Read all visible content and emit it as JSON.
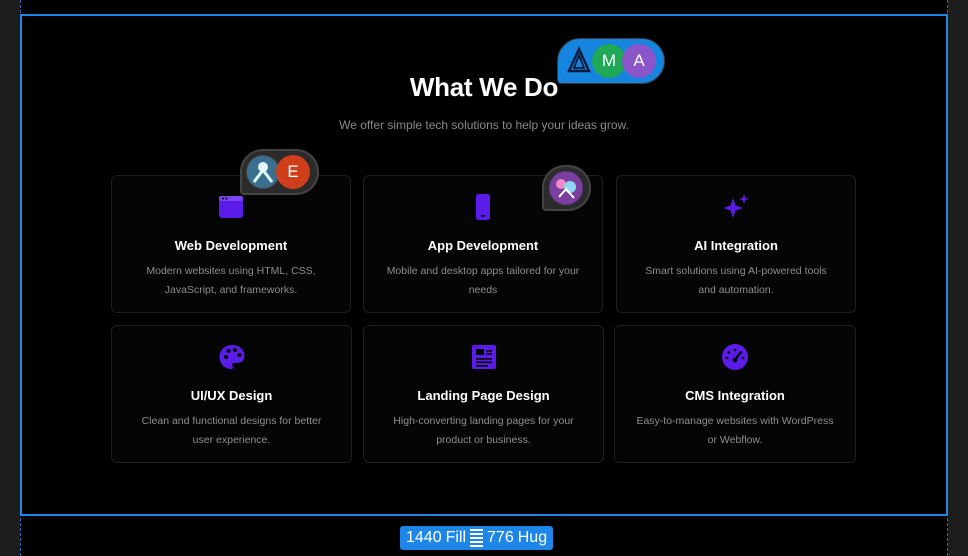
{
  "section": {
    "title": "What We Do",
    "subtitle": "We offer simple tech solutions to help your ideas grow."
  },
  "services": [
    {
      "name": "Web Development",
      "desc": "Modern websites using HTML, CSS, JavaScript, and frameworks.",
      "icon": "browser-window-icon"
    },
    {
      "name": "App Development",
      "desc": "Mobile and desktop apps tailored for your needs",
      "icon": "mobile-device-icon"
    },
    {
      "name": "AI Integration",
      "desc": "Smart solutions using AI-powered tools and automation.",
      "icon": "sparkles-icon"
    },
    {
      "name": "UI/UX Design",
      "desc": "Clean and functional designs for better user experience.",
      "icon": "palette-icon"
    },
    {
      "name": "Landing Page Design",
      "desc": "High-converting landing pages for your product or business.",
      "icon": "newspaper-icon"
    },
    {
      "name": "CMS Integration",
      "desc": "Easy-to-manage websites with WordPress or Webflow.",
      "icon": "gauge-icon"
    }
  ],
  "collaborators": {
    "title_group": [
      "M",
      "A"
    ],
    "card_group": [
      "E"
    ]
  },
  "frame_badge": {
    "width_value": "1440",
    "width_mode": "Fill",
    "height_value": "776",
    "height_mode": "Hug"
  },
  "colors": {
    "accent": "#5b1be8",
    "selection": "#1d86e6",
    "avatar_m": "#1fa855",
    "avatar_a": "#8a55c9",
    "avatar_e": "#cf3f1b"
  }
}
